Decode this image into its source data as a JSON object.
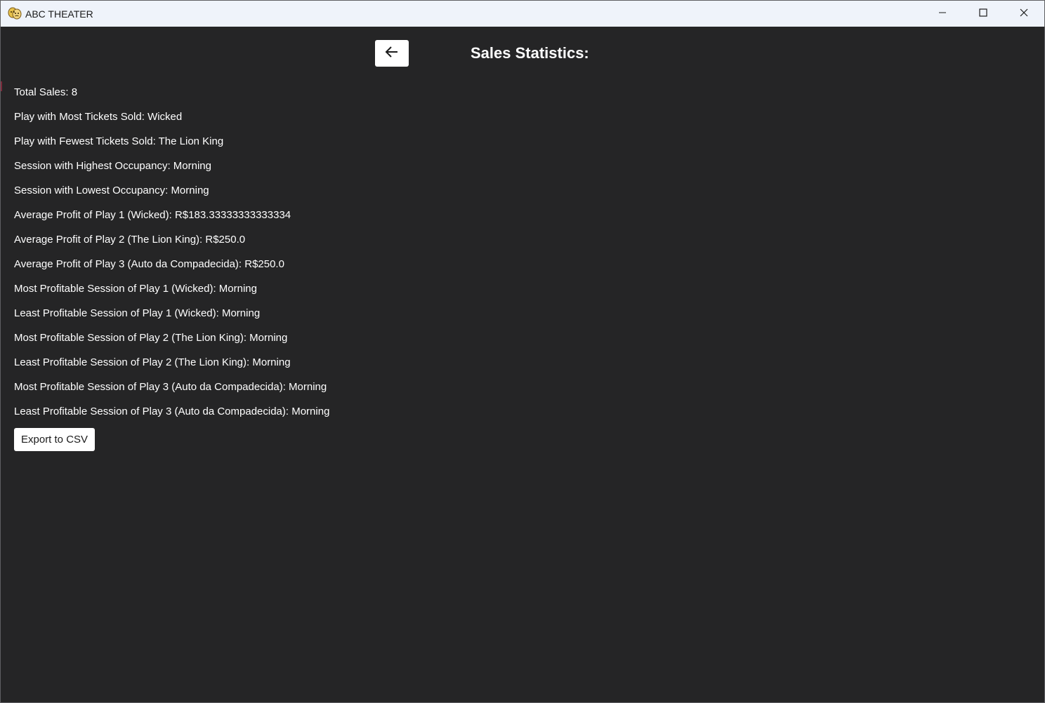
{
  "window": {
    "title": "ABC THEATER",
    "icon": "theater-masks-icon"
  },
  "header": {
    "back_icon": "arrow-left-icon",
    "title": "Sales Statistics:"
  },
  "stats": [
    "Total Sales: 8",
    "Play with Most Tickets Sold: Wicked",
    "Play with Fewest Tickets Sold: The Lion King",
    "Session with Highest Occupancy: Morning",
    "Session with Lowest Occupancy: Morning",
    "Average Profit of Play 1 (Wicked): R$183.33333333333334",
    "Average Profit of Play 2 (The Lion King): R$250.0",
    "Average Profit of Play 3 (Auto da Compadecida): R$250.0",
    "Most Profitable Session of Play 1 (Wicked): Morning",
    "Least Profitable Session of Play 1 (Wicked): Morning",
    "Most Profitable Session of Play 2 (The Lion King): Morning",
    "Least Profitable Session of Play 2 (The Lion King): Morning",
    "Most Profitable Session of Play 3 (Auto da Compadecida): Morning",
    "Least Profitable Session of Play 3 (Auto da Compadecida): Morning"
  ],
  "actions": {
    "export_label": "Export to CSV"
  },
  "colors": {
    "background": "#252526",
    "titlebar": "#eff3fa",
    "text": "#ffffff",
    "button": "#ffffff"
  }
}
